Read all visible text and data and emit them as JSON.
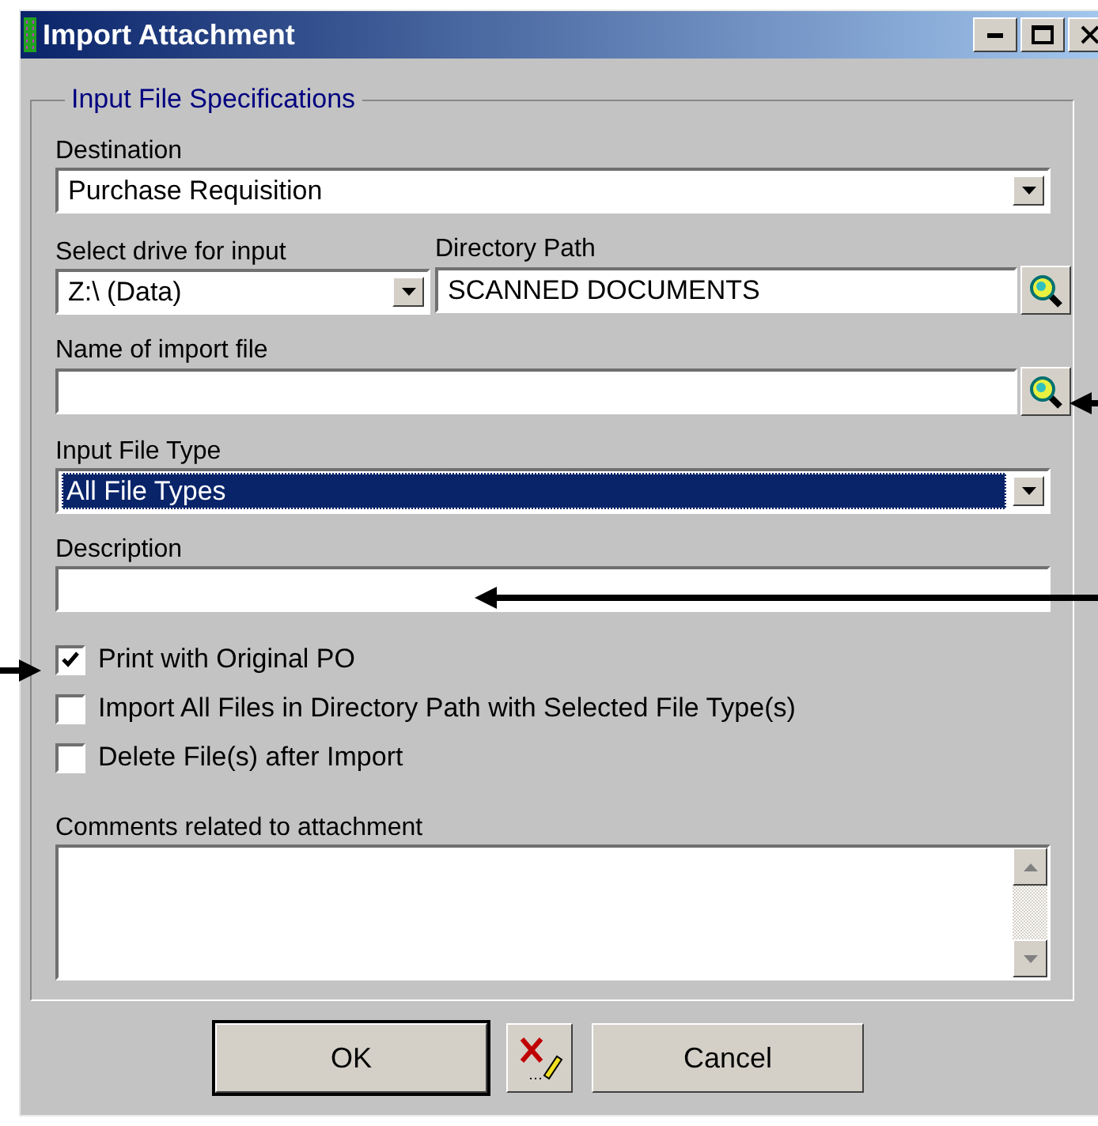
{
  "window": {
    "title": "Import Attachment"
  },
  "group": {
    "title": "Input File Specifications"
  },
  "destination": {
    "label": "Destination",
    "value": "Purchase Requisition"
  },
  "drive": {
    "label": "Select drive for input",
    "value": "Z:\\ (Data)"
  },
  "directory": {
    "label": "Directory Path",
    "value": "SCANNED DOCUMENTS"
  },
  "import_file": {
    "label": "Name of import file"
  },
  "file_type": {
    "label": "Input File Type",
    "value": "All File Types",
    "selected": true
  },
  "description": {
    "label": "Description"
  },
  "options": [
    {
      "label": "Print with Original PO",
      "checked": true
    },
    {
      "label": "Import All Files in Directory Path with Selected File Type(s)",
      "checked": false
    },
    {
      "label": "Delete File(s) after Import",
      "checked": false
    }
  ],
  "comments": {
    "label": "Comments related to attachment"
  },
  "buttons": [
    {
      "kind": "text",
      "label": "OK",
      "default": true
    },
    {
      "kind": "icon"
    },
    {
      "kind": "text",
      "label": "Cancel",
      "default": false
    }
  ]
}
